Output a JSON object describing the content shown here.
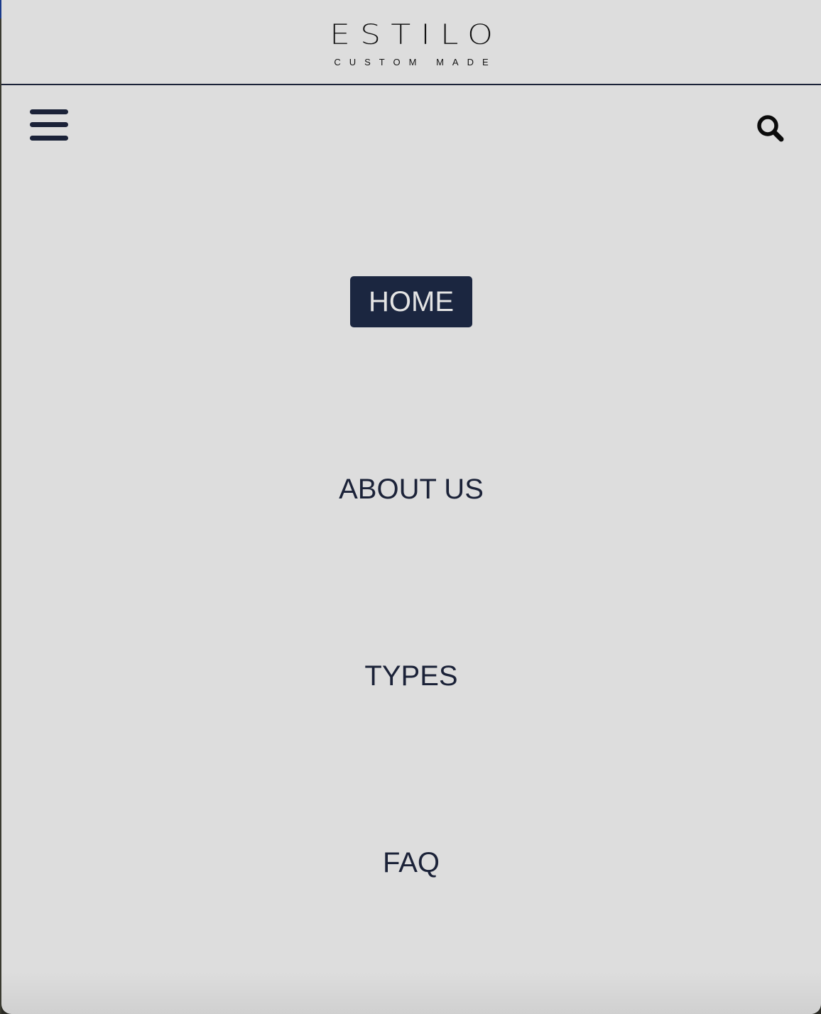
{
  "brand": {
    "wordmark": "ESTILO",
    "tagline": "CUSTOM MADE"
  },
  "toolbar": {
    "menu_icon": "hamburger-menu-icon",
    "search_icon": "search-icon"
  },
  "nav": {
    "items": [
      {
        "label": "HOME",
        "active": true
      },
      {
        "label": "ABOUT US",
        "active": false
      },
      {
        "label": "TYPES",
        "active": false
      },
      {
        "label": "FAQ",
        "active": false
      }
    ]
  },
  "colors": {
    "panel_background": "#dddddd",
    "navy": "#1b2238",
    "active_background": "#1b2640",
    "active_text": "#e4e4e4"
  }
}
